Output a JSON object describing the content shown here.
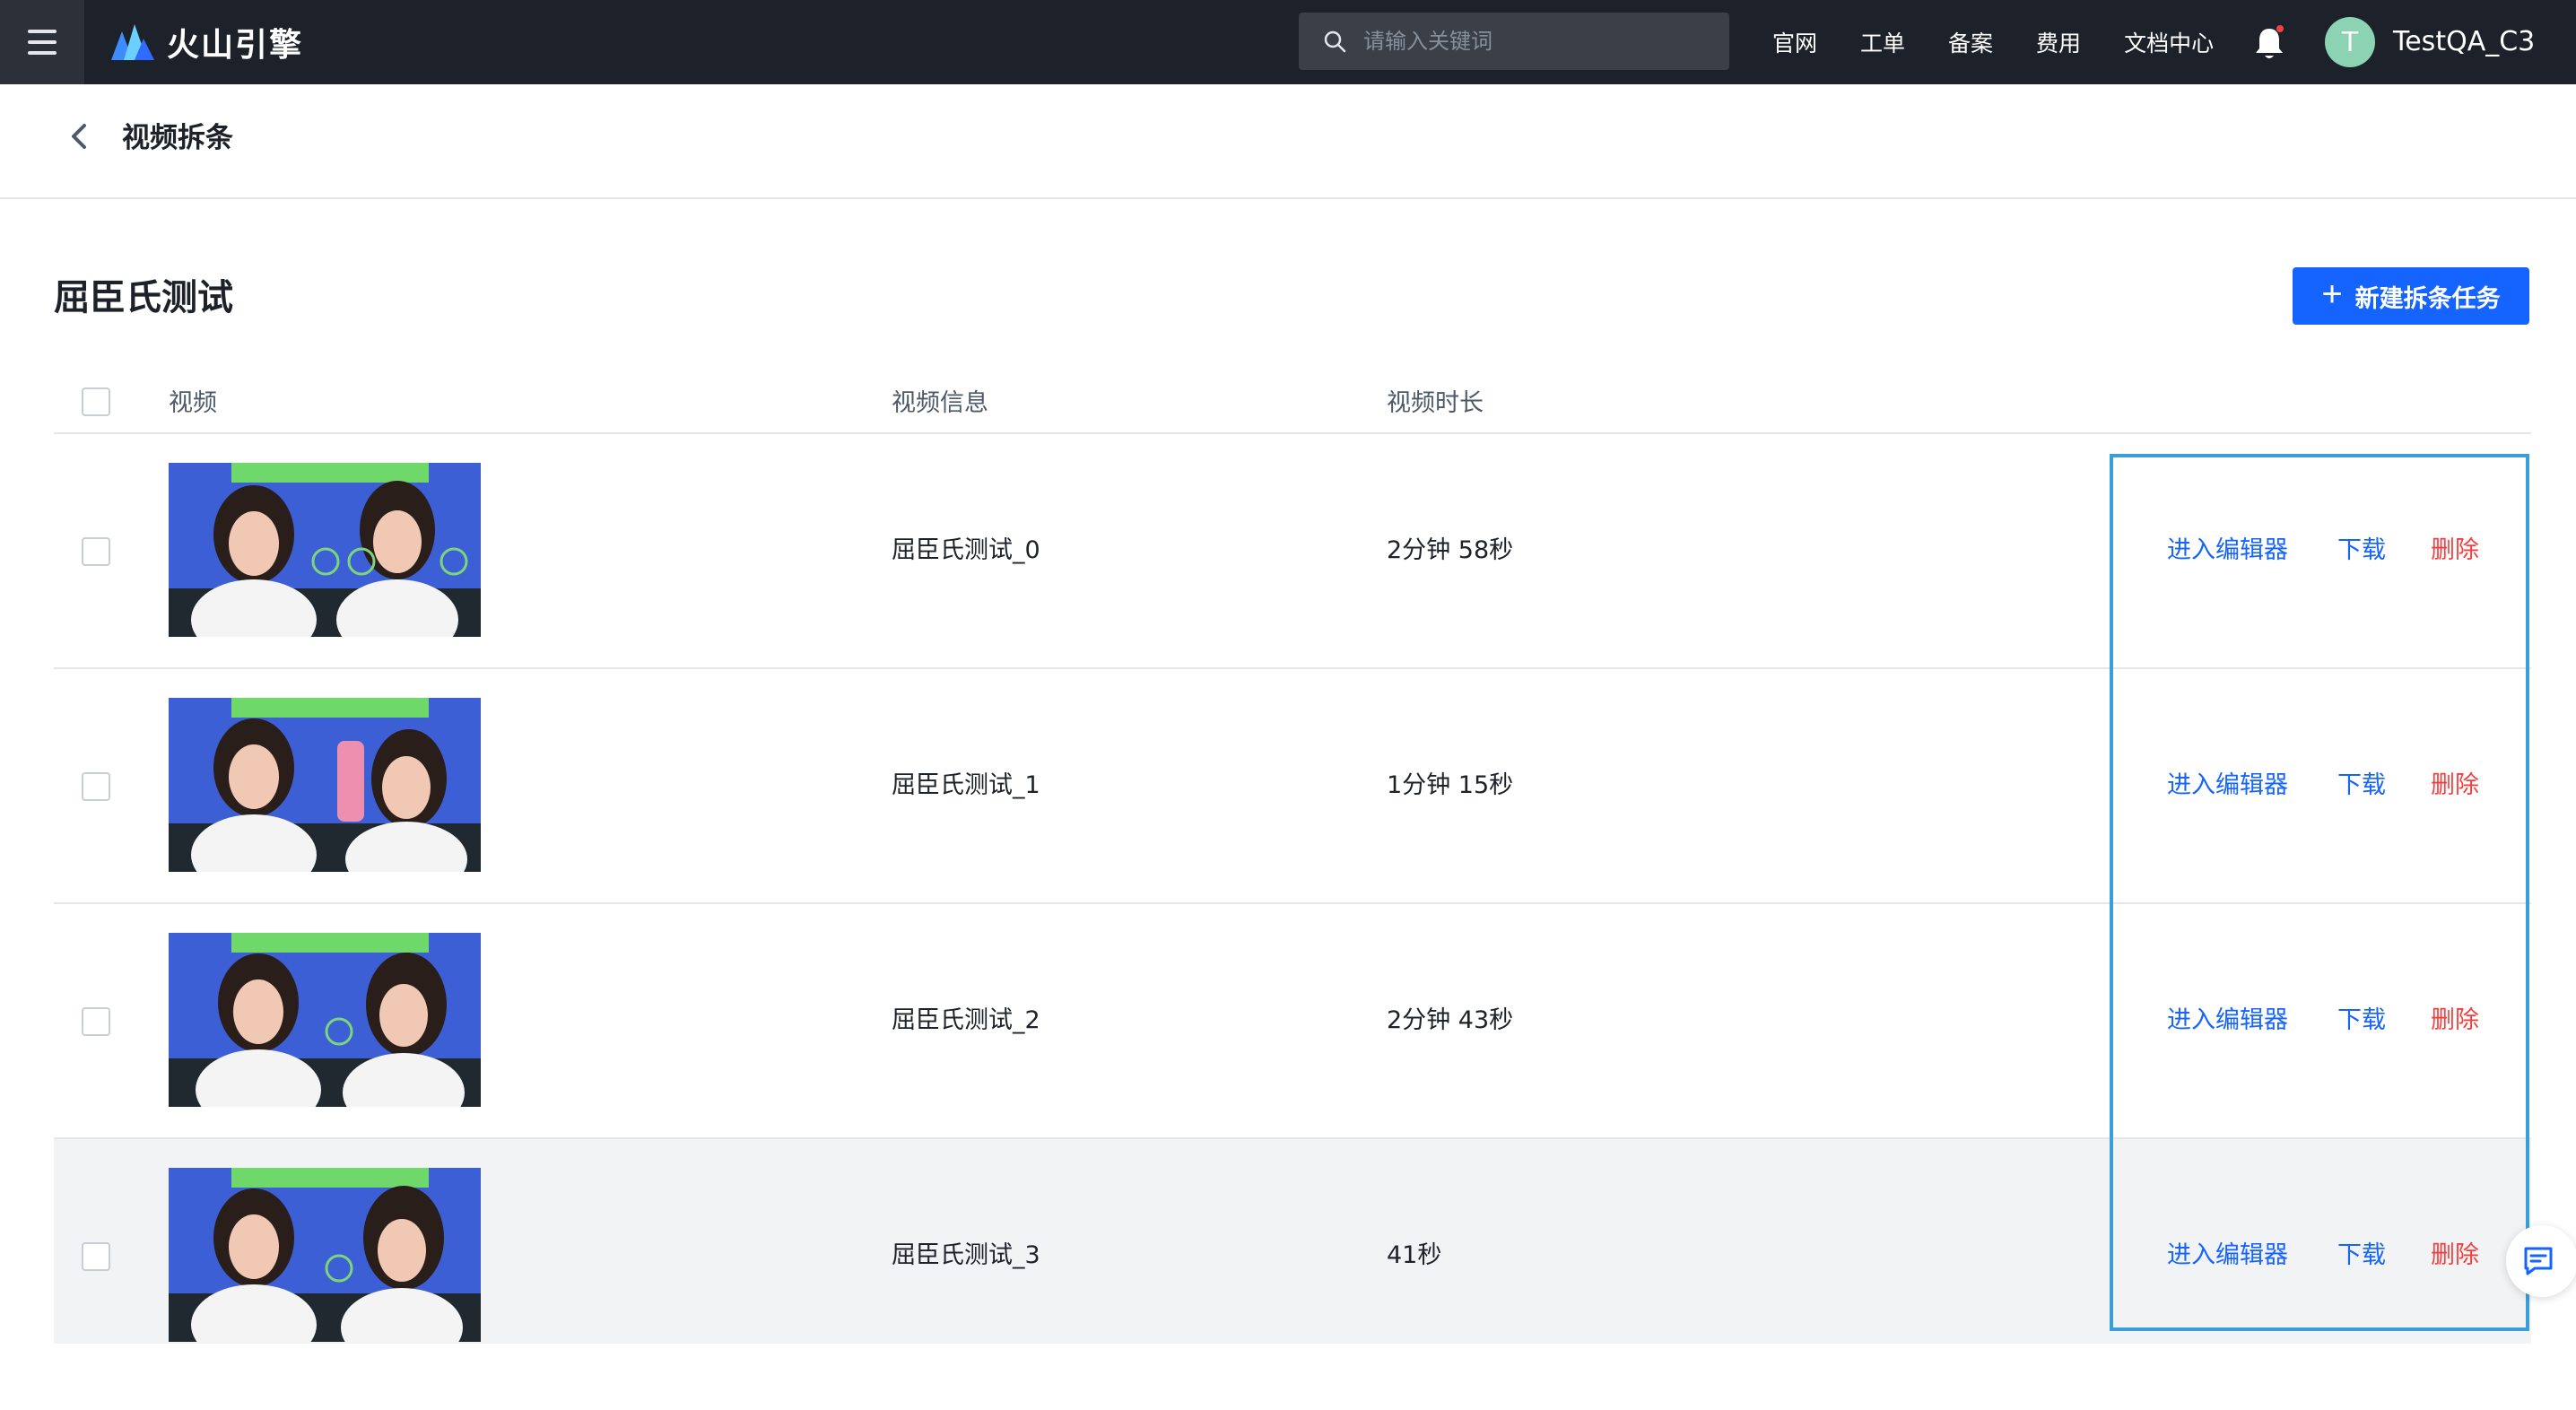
{
  "topbar": {
    "logo_text": "火山引擎",
    "search_placeholder": "请输入关键词",
    "nav": [
      "官网",
      "工单",
      "备案",
      "费用",
      "文档中心"
    ],
    "avatar_letter": "T",
    "username": "TestQA_C3"
  },
  "subheader": {
    "title": "视频拆条"
  },
  "section": {
    "title": "屈臣氏测试",
    "new_button_label": "新建拆条任务"
  },
  "table": {
    "headers": {
      "video": "视频",
      "info": "视频信息",
      "duration": "视频时长"
    },
    "rows": [
      {
        "info": "屈臣氏测试_0",
        "duration": "2分钟 58秒"
      },
      {
        "info": "屈臣氏测试_1",
        "duration": "1分钟 15秒"
      },
      {
        "info": "屈臣氏测试_2",
        "duration": "2分钟 43秒"
      },
      {
        "info": "屈臣氏测试_3",
        "duration": "41秒"
      }
    ],
    "actions": {
      "edit": "进入编辑器",
      "download": "下载",
      "delete": "删除"
    }
  },
  "colors": {
    "topbar": "#1d2129",
    "primary": "#1664ff",
    "danger": "#f53f3f",
    "highlight": "#3a9fd8"
  }
}
